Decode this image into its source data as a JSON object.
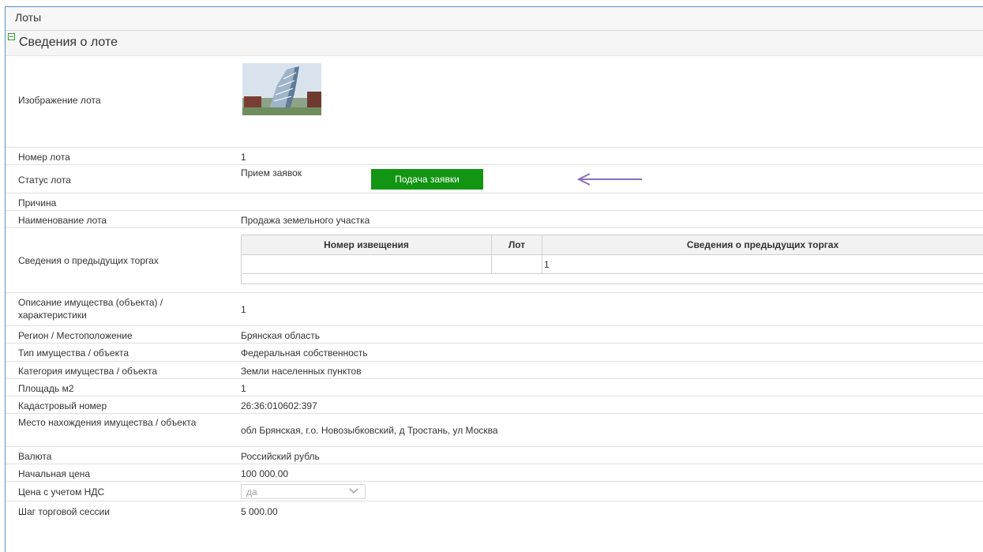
{
  "header": {
    "title": "Лоты"
  },
  "section": {
    "title": "Сведения о лоте"
  },
  "fields": {
    "image_label": "Изображение лота",
    "lot_number_label": "Номер лота",
    "lot_number_value": "1",
    "status_label": "Статус лота",
    "status_value": "Прием заявок",
    "submit_button": "Подача заявки",
    "reason_label": "Причина",
    "name_label": "Наименование лота",
    "name_value": "Продажа земельного участка",
    "prev_label": "Сведения о предыдущих торгах",
    "description_label": "Описание имущества (объекта) / характеристики",
    "description_value": "1",
    "region_label": "Регион / Местоположение",
    "region_value": "Брянская область",
    "type_label": "Тип имущества / объекта",
    "type_value": "Федеральная собственность",
    "category_label": "Категория имущества / объекта",
    "category_value": "Земли населенных пунктов",
    "area_label": "Площадь м2",
    "area_value": "1",
    "cadastral_label": "Кадастровый номер",
    "cadastral_value": "26:36:010602:397",
    "location_label": "Место нахождения имущества / объекта",
    "location_value": "обл Брянская, г.о. Новозыбковский, д Тростань, ул Москва",
    "currency_label": "Валюта",
    "currency_value": "Российский рубль",
    "start_price_label": "Начальная цена",
    "start_price_value": "100 000.00",
    "vat_label": "Цена с учетом НДС",
    "vat_value": "да",
    "step_label": "Шаг торговой сессии",
    "step_value": "5 000.00"
  },
  "prev_table": {
    "headers": [
      "Номер извещения",
      "Лот",
      "Сведения о предыдущих торгах"
    ],
    "rows": [
      [
        "",
        "",
        "1"
      ]
    ]
  },
  "colors": {
    "accent": "#129512",
    "arrow": "#8a6fb5",
    "frame": "#5b8fc9"
  }
}
